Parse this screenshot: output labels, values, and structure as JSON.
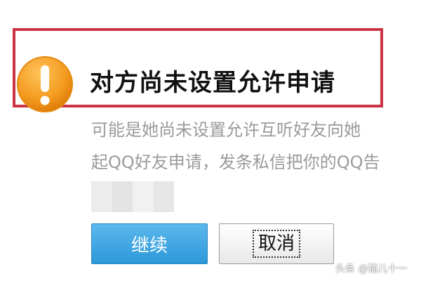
{
  "dialog": {
    "title": "对方尚未设置允许申请",
    "message_line1": "可能是她尚未设置允许互听好友向她",
    "message_line2": "起QQ好友申请，发条私信把你的QQ告",
    "icon": "warning-exclamation-icon"
  },
  "buttons": {
    "continue_label": "继续",
    "cancel_label": "取消"
  },
  "watermark": "头条 @猫儿十一",
  "colors": {
    "highlight_border": "#cc3344",
    "warning_orange": "#f39a1e",
    "continue_button": "#2d98d9",
    "message_text": "#9a9a9a"
  }
}
